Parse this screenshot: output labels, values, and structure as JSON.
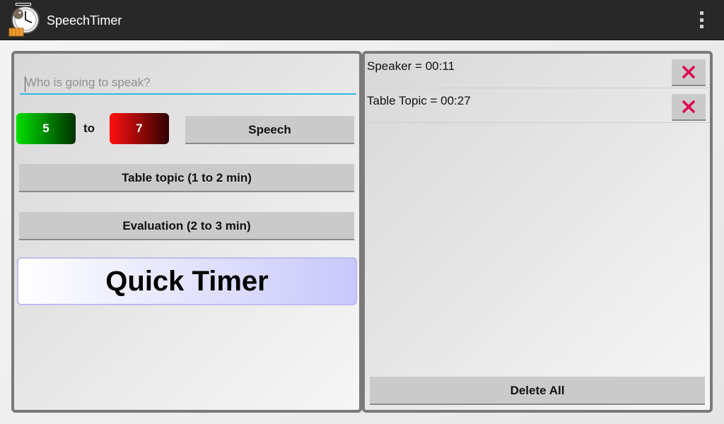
{
  "app": {
    "title": "SpeechTimer",
    "icon": "stopwatch-app-icon"
  },
  "actionbar": {
    "overflow_icon": "overflow-menu-icon"
  },
  "speaker_input": {
    "placeholder": "Who is going to speak?",
    "value": ""
  },
  "speech_range": {
    "min": "5",
    "separator": "to",
    "max": "7",
    "button_label": "Speech",
    "min_color": "#00e000",
    "max_color": "#ff1010"
  },
  "buttons": {
    "table_topic": "Table topic (1 to 2 min)",
    "evaluation": "Evaluation (2 to 3 min)",
    "quick_timer": "Quick Timer"
  },
  "records": [
    {
      "text": "Speaker = 00:11",
      "delete_icon": "close-x-icon"
    },
    {
      "text": "Table Topic = 00:27",
      "delete_icon": "close-x-icon"
    }
  ],
  "delete_all_label": "Delete All",
  "colors": {
    "accent": "#33b5e5",
    "delete": "#e0004d",
    "actionbar": "#282828"
  }
}
